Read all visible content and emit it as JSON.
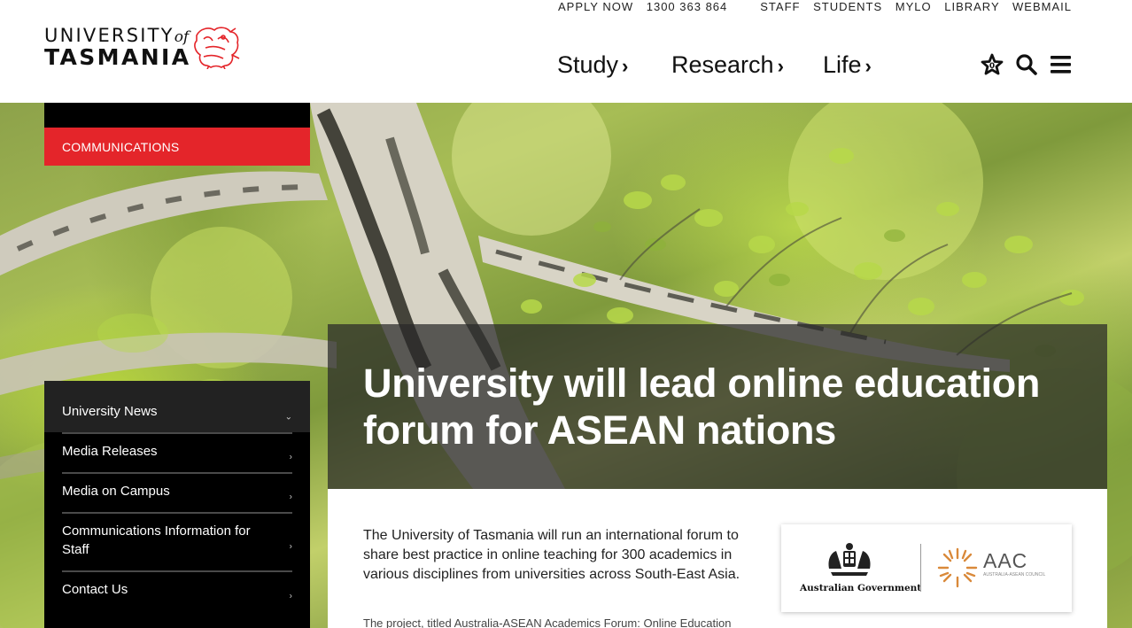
{
  "brand": {
    "line1": "UNIVERSITY",
    "of": "of",
    "line2": "TASMANIA",
    "red": "#e4252a"
  },
  "utility_left": [
    "APPLY NOW",
    "1300 363 864"
  ],
  "utility_right": [
    "STAFF",
    "STUDENTS",
    "MYLO",
    "LIBRARY",
    "WEBMAIL"
  ],
  "main_nav": [
    {
      "label": "Study",
      "icon": "chevron-right-icon"
    },
    {
      "label": "Research",
      "icon": "chevron-right-icon"
    },
    {
      "label": "Life",
      "icon": "chevron-right-icon"
    }
  ],
  "header_icons": [
    "star-badge-icon",
    "search-icon",
    "menu-icon"
  ],
  "section": {
    "label": "COMMUNICATIONS"
  },
  "sidenav": [
    {
      "label": "University News",
      "icon": "chevron-down-icon"
    },
    {
      "label": "Media Releases",
      "icon": "chevron-right-icon"
    },
    {
      "label": "Media on Campus",
      "icon": "chevron-right-icon"
    },
    {
      "label": "Communications Information for Staff",
      "icon": "chevron-right-icon"
    },
    {
      "label": "Contact Us",
      "icon": "chevron-right-icon"
    }
  ],
  "article": {
    "title": "University will lead online education forum for ASEAN nations",
    "lead": "The University of Tasmania will run an international forum to share best practice in online teaching for 300 academics in various disciplines from universities across South-East Asia.",
    "second_paragraph": "The project, titled Australia-ASEAN Academics Forum: Online Education"
  },
  "partner_logos": {
    "gov_label": "Australian Government",
    "aac_label": "AAC",
    "aac_sub": "AUSTRALIA-ASEAN COUNCIL"
  }
}
